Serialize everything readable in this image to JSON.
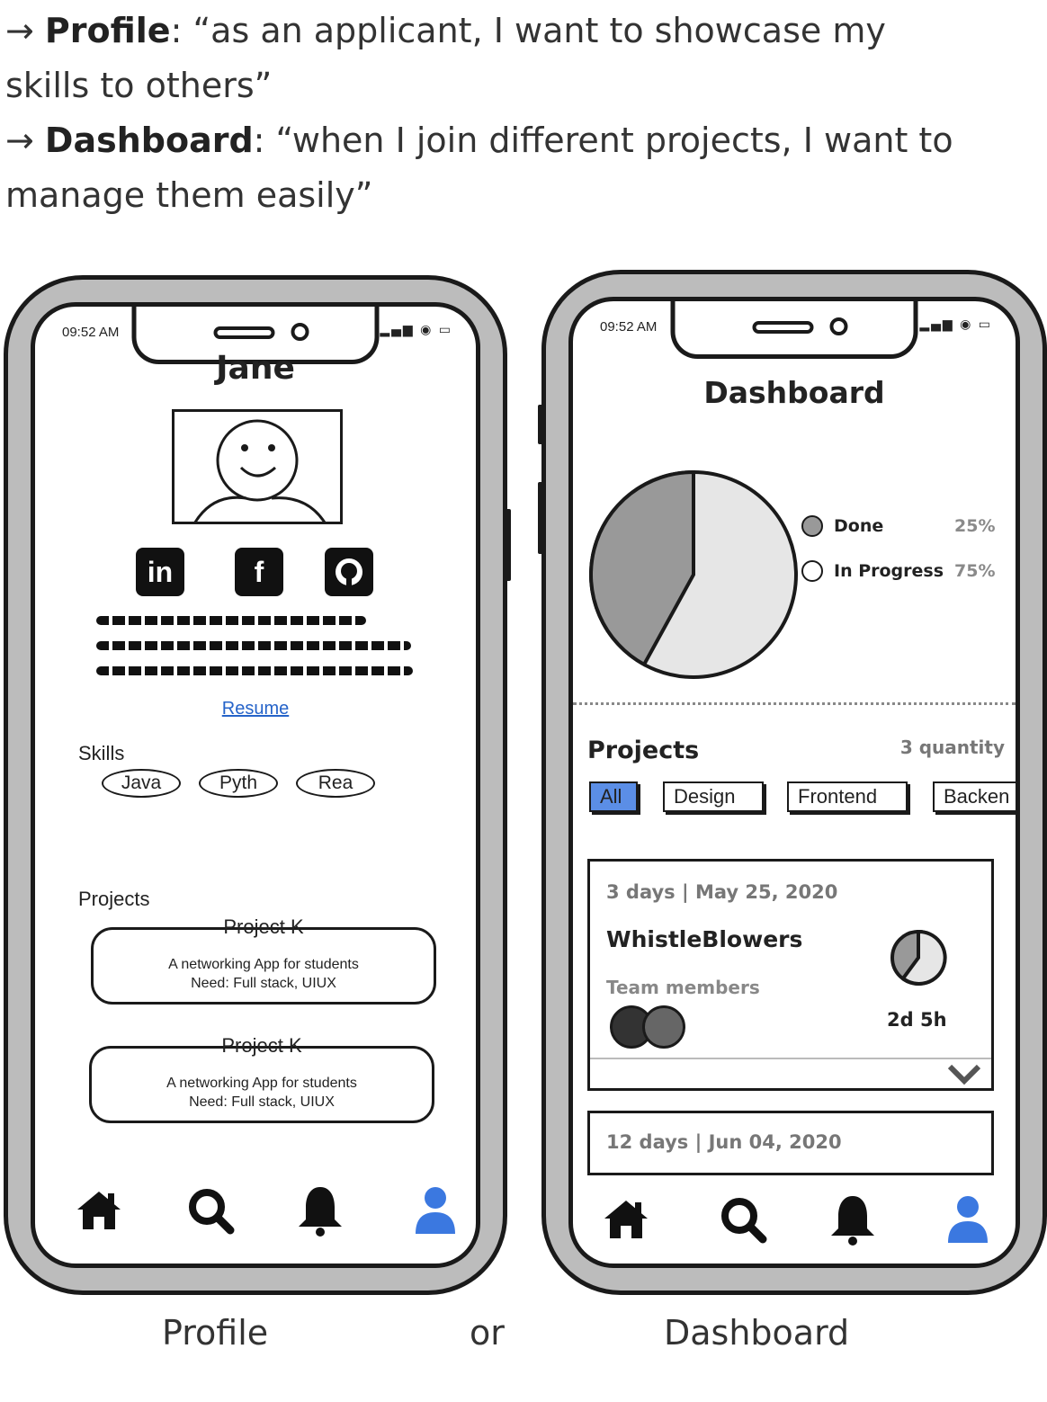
{
  "intro": {
    "profile_label": "Profile",
    "profile_text_1": ": “as an applicant, I want to showcase my",
    "profile_text_2": "skills to others”",
    "dashboard_label": "Dashboard",
    "dashboard_text_1": ": “when I join different projects, I want to",
    "dashboard_text_2": "manage them easily”"
  },
  "profile_screen": {
    "time": "09:52 AM",
    "name": "Jane",
    "resume_link": "Resume",
    "skills_label": "Skills",
    "skills": [
      "Java",
      "Pyth",
      "Rea"
    ],
    "projects_label": "Projects",
    "projects": [
      {
        "title": "Project K",
        "line1": "A networking App for students",
        "line2": "Need: Full stack, UIUX"
      },
      {
        "title": "Project K",
        "line1": "A networking App for students",
        "line2": "Need: Full stack, UIUX"
      }
    ],
    "social_icons": [
      "linkedin-icon",
      "facebook-icon",
      "github-icon"
    ]
  },
  "dashboard_screen": {
    "time": "09:52 AM",
    "title": "Dashboard",
    "legend": [
      {
        "label": "Done",
        "value": "25%",
        "color": "#999999"
      },
      {
        "label": "In Progress",
        "value": "75%",
        "color": "#e6e6e6"
      }
    ],
    "pie": {
      "done_fraction": 0.42
    },
    "projects_title": "Projects",
    "quantity": "3 quantity",
    "filters": [
      "All",
      "Design",
      "Frontend",
      "Backen"
    ],
    "active_filter": "All",
    "cards": [
      {
        "meta": "3 days | May 25, 2020",
        "title": "WhistleBlowers",
        "team_label": "Team members",
        "time_left": "2d 5h"
      },
      {
        "meta": "12 days | Jun 04, 2020"
      }
    ]
  },
  "tabbar_icons": [
    "home-icon",
    "search-icon",
    "bell-icon",
    "user-icon"
  ],
  "accent_color": "#3b78e0",
  "captions": {
    "left": "Profile",
    "middle": "or",
    "right": "Dashboard"
  }
}
